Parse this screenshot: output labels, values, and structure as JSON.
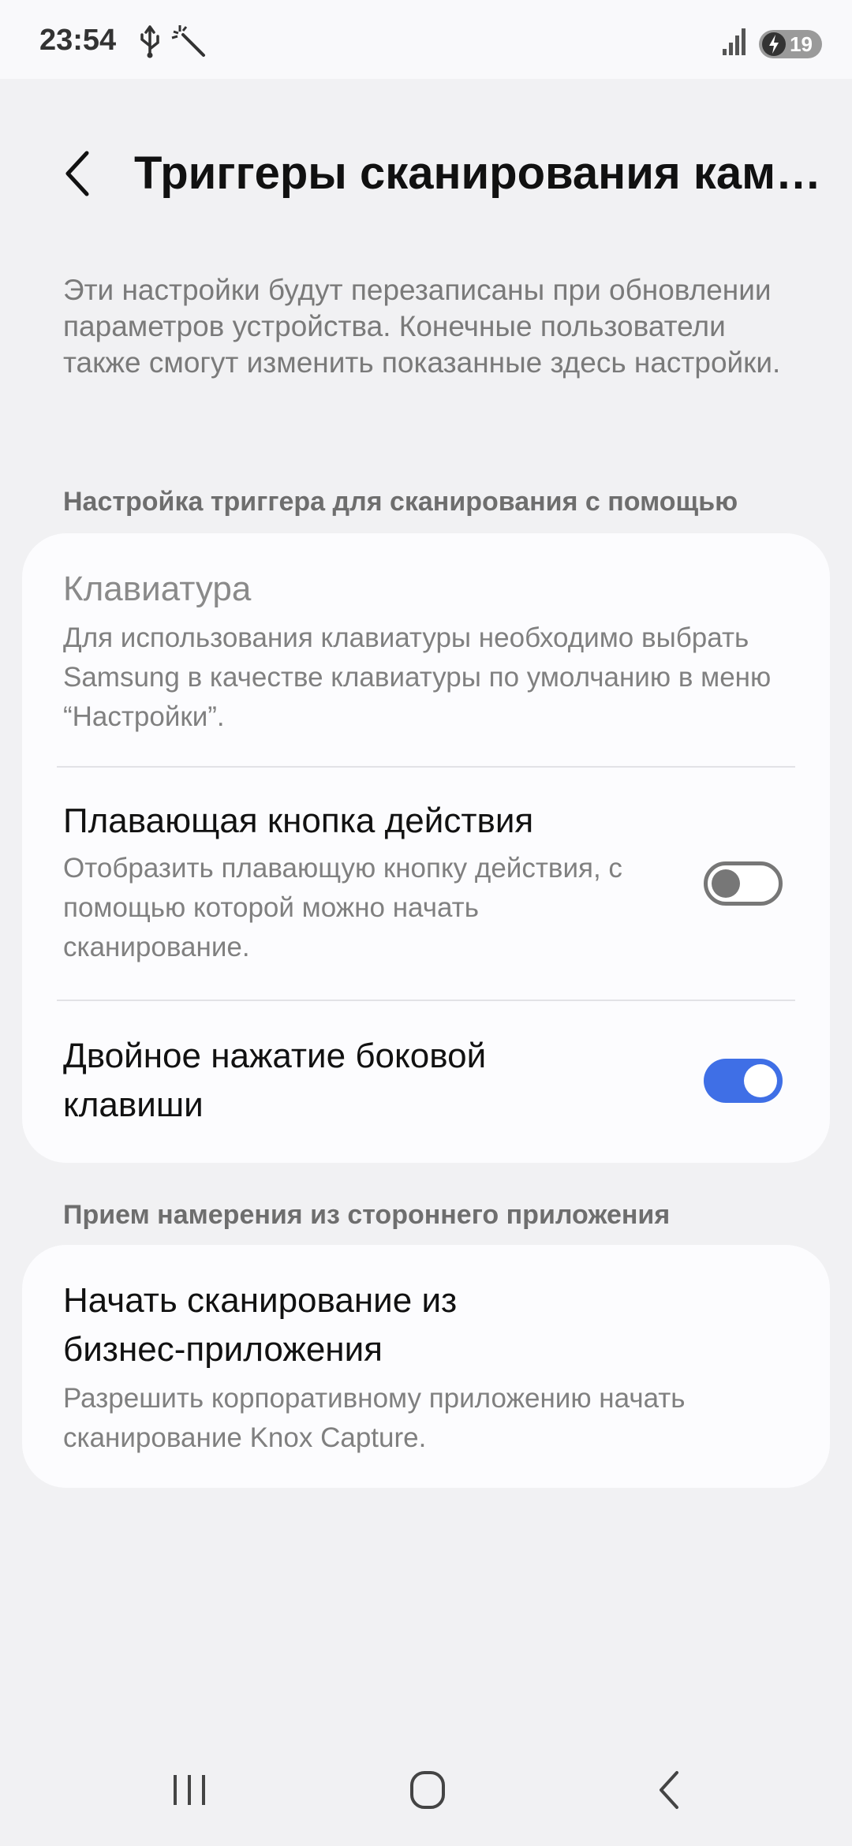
{
  "status_bar": {
    "time": "23:54",
    "battery_level": "19",
    "icons": [
      "usb-icon",
      "magic-wand-icon",
      "signal-icon",
      "battery-charging-icon"
    ]
  },
  "header": {
    "title": "Триггеры сканирования камеры"
  },
  "description": "Эти настройки будут перезаписаны при обновлении параметров устройства. Конечные пользователи также смогут изменить показанные здесь настройки.",
  "section1": {
    "header": "Настройка триггера для сканирования с помощью",
    "items": [
      {
        "title": "Клавиатура",
        "description": "Для использования клавиатуры необходимо выбрать Samsung в качестве клавиатуры по умолчанию в меню “Настройки”."
      },
      {
        "title": "Плавающая кнопка действия",
        "description": "Отобразить плавающую кнопку действия, с помощью которой можно начать сканирование.",
        "toggle": "off"
      },
      {
        "title": "Двойное нажатие боковой клавиши",
        "toggle": "on"
      }
    ]
  },
  "section2": {
    "header": "Прием намерения из стороннего приложения",
    "items": [
      {
        "title": "Начать сканирование из бизнес-приложения",
        "description": "Разрешить корпоративному приложению начать сканирование Knox Capture."
      }
    ]
  },
  "colors": {
    "accent": "#3f6fe6",
    "background": "#f1f1f3",
    "card": "#fcfcfe"
  }
}
